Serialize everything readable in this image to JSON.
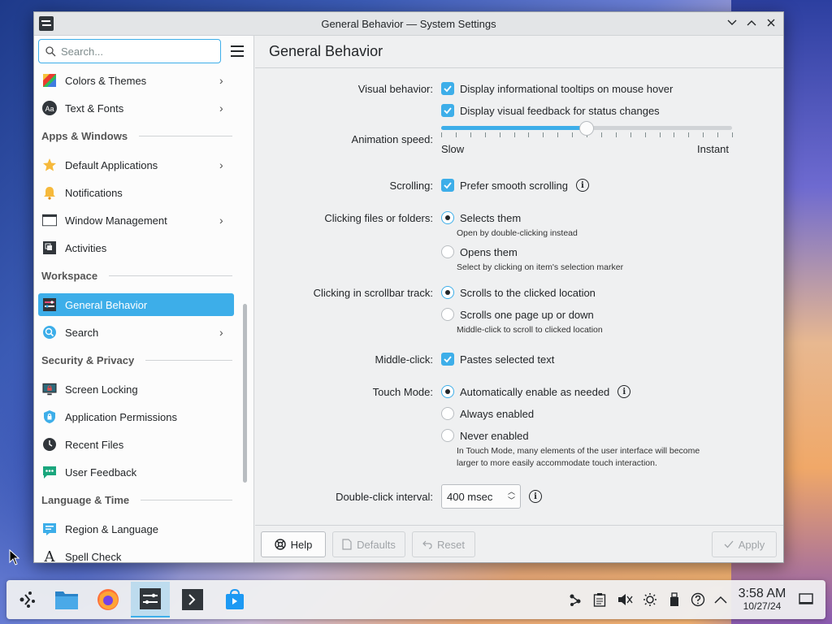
{
  "window": {
    "title": "General Behavior — System Settings"
  },
  "sidebar": {
    "search_placeholder": "Search...",
    "items": [
      {
        "label": "Colors & Themes",
        "icon": "colors-themes-icon",
        "chevron": true
      },
      {
        "label": "Text & Fonts",
        "icon": "text-fonts-icon",
        "chevron": true
      },
      {
        "label": "Default Applications",
        "icon": "star-icon",
        "chevron": true
      },
      {
        "label": "Notifications",
        "icon": "bell-icon",
        "chevron": false
      },
      {
        "label": "Window Management",
        "icon": "window-icon",
        "chevron": true
      },
      {
        "label": "Activities",
        "icon": "activities-icon",
        "chevron": false
      },
      {
        "label": "General Behavior",
        "icon": "general-behavior-icon",
        "chevron": false,
        "selected": true
      },
      {
        "label": "Search",
        "icon": "search-globe-icon",
        "chevron": true
      },
      {
        "label": "Screen Locking",
        "icon": "screen-lock-icon",
        "chevron": false
      },
      {
        "label": "Application Permissions",
        "icon": "shield-icon",
        "chevron": false
      },
      {
        "label": "Recent Files",
        "icon": "clock-icon",
        "chevron": false
      },
      {
        "label": "User Feedback",
        "icon": "feedback-icon",
        "chevron": false
      },
      {
        "label": "Region & Language",
        "icon": "region-icon",
        "chevron": false
      },
      {
        "label": "Spell Check",
        "icon": "spell-check-icon",
        "chevron": false
      }
    ],
    "sections": [
      "Apps & Windows",
      "Workspace",
      "Security & Privacy",
      "Language & Time"
    ]
  },
  "main": {
    "title": "General Behavior",
    "visual_behavior": {
      "label": "Visual behavior:",
      "opt1": "Display informational tooltips on mouse hover",
      "opt2": "Display visual feedback for status changes"
    },
    "animation": {
      "label": "Animation speed:",
      "min_label": "Slow",
      "max_label": "Instant",
      "value_fraction": 0.5
    },
    "scrolling": {
      "label": "Scrolling:",
      "opt": "Prefer smooth scrolling"
    },
    "clicking": {
      "label": "Clicking files or folders:",
      "opt1": "Selects them",
      "hint1": "Open by double-clicking instead",
      "opt2": "Opens them",
      "hint2": "Select by clicking on item's selection marker"
    },
    "scrollbar": {
      "label": "Clicking in scrollbar track:",
      "opt1": "Scrolls to the clicked location",
      "opt2": "Scrolls one page up or down",
      "hint2": "Middle-click to scroll to clicked location"
    },
    "middle_click": {
      "label": "Middle-click:",
      "opt": "Pastes selected text"
    },
    "touch": {
      "label": "Touch Mode:",
      "opt1": "Automatically enable as needed",
      "opt2": "Always enabled",
      "opt3": "Never enabled",
      "hint_line1": "In Touch Mode, many elements of the user interface will become",
      "hint_line2": "larger to more easily accommodate touch interaction."
    },
    "double_click": {
      "label": "Double-click interval:",
      "value": "400 msec"
    }
  },
  "buttons": {
    "help": "Help",
    "defaults": "Defaults",
    "reset": "Reset",
    "apply": "Apply"
  },
  "taskbar": {
    "time": "3:58 AM",
    "date": "10/27/24"
  },
  "colors": {
    "accent": "#3daee9",
    "window_bg": "#eff0f1"
  }
}
